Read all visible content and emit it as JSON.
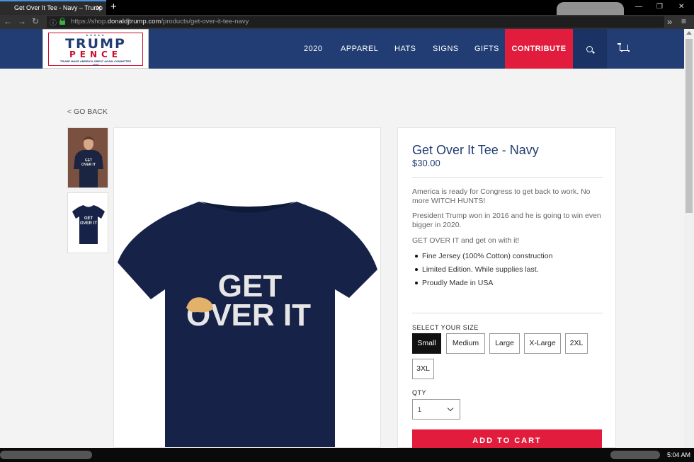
{
  "browser": {
    "tab_title": "Get Over It Tee - Navy – Trump",
    "new_tab_icon": "plus-icon",
    "url_prefix": "https://shop.",
    "url_host": "donaldjtrump.com",
    "url_path": "/products/get-over-it-tee-navy"
  },
  "site": {
    "logo": {
      "line1": "TRUMP",
      "line2": "PENCE",
      "line3": "TRUMP MAKE AMERICA GREAT AGAIN COMMITTEE",
      "line4": "2020"
    },
    "nav": [
      "2020",
      "APPAREL",
      "HATS",
      "SIGNS",
      "GIFTS"
    ],
    "contribute": "CONTRIBUTE",
    "colors": {
      "navy": "#213d73",
      "red": "#e21c3c"
    }
  },
  "product": {
    "go_back": "< GO BACK",
    "title": "Get Over It Tee - Navy",
    "price": "$30.00",
    "desc1": "America is ready for Congress to get back to work. No more WITCH HUNTS!",
    "desc2": "President Trump won in 2016 and he is going to win even bigger in 2020.",
    "desc3": "GET OVER IT and get on with it!",
    "bullets": [
      "Fine Jersey (100% Cotton) construction",
      "Limited Edition. While supplies last.",
      "Proudly Made in USA"
    ],
    "size_label": "SELECT YOUR SIZE",
    "sizes": [
      "Small",
      "Medium",
      "Large",
      "X-Large",
      "2XL",
      "3XL"
    ],
    "selected_size": "Small",
    "qty_label": "QTY",
    "qty_value": "1",
    "add_to_cart": "ADD TO CART",
    "shirt_text1": "GET",
    "shirt_text2": "OVER IT",
    "thumb_text1": "GET",
    "thumb_text2": "OVER IT"
  },
  "taskbar": {
    "time": "5:04 AM"
  }
}
